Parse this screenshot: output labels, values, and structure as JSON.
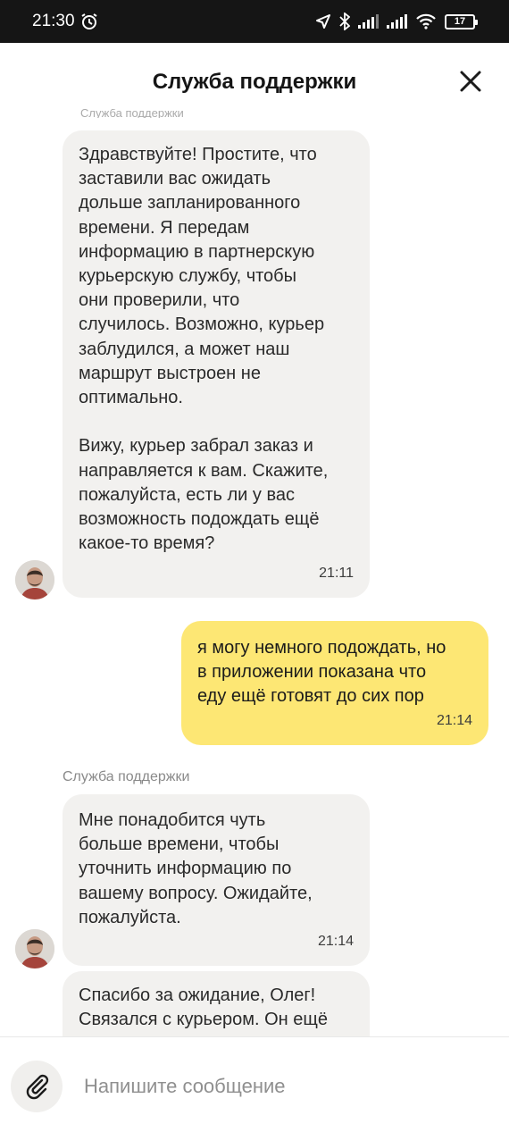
{
  "status_bar": {
    "time": "21:30",
    "battery": "17",
    "icons": [
      "alarm-icon",
      "location-arrow-icon",
      "bluetooth-icon",
      "signal-icon",
      "signal-icon",
      "wifi-icon",
      "battery-icon"
    ]
  },
  "header": {
    "title": "Служба поддержки",
    "close_icon": "close-icon"
  },
  "messages": [
    {
      "from": "support",
      "text": "Здравствуйте! Простите, что\nзаставили вас ожидать\nдольше запланированного\nвремени. Я передам\nинформацию в партнерскую\nкурьерскую службу, чтобы\nони проверили, что\nслучилось. Возможно, курьер\nзаблудился, а может наш\nмаршрут выстроен не\nоптимально.\n\nВижу, курьер забрал заказ и\nнаправляется к вам. Скажите,\nпожалуйста, есть ли у вас\nвозможность подождать ещё\nкакое-то время?",
      "time": "21:11"
    },
    {
      "from": "user",
      "text": "я могу немного подождать, но\nв приложении показана что\nеду ещё готовят до сих пор",
      "time": "21:14"
    },
    {
      "from": "support",
      "sender": "Служба поддержки",
      "text": "Мне понадобится чуть\nбольше времени, чтобы\nуточнить информацию по\nвашему вопросу. Ожидайте,\nпожалуйста.",
      "time": "21:14"
    },
    {
      "from": "support",
      "text": "Спасибо за ожидание, Олег!\nСвязался с курьером. Он ещё"
    }
  ],
  "composer": {
    "placeholder": "Напишите сообщение",
    "value": "",
    "attach_icon": "paperclip-icon"
  },
  "colors": {
    "status_bar": "#151515",
    "incoming_bubble": "#f2f1ef",
    "outgoing_bubble": "#fde774",
    "timestamp": "#3c3c3c",
    "sender_label": "#8a8a8a",
    "placeholder": "#8f8f8f"
  }
}
